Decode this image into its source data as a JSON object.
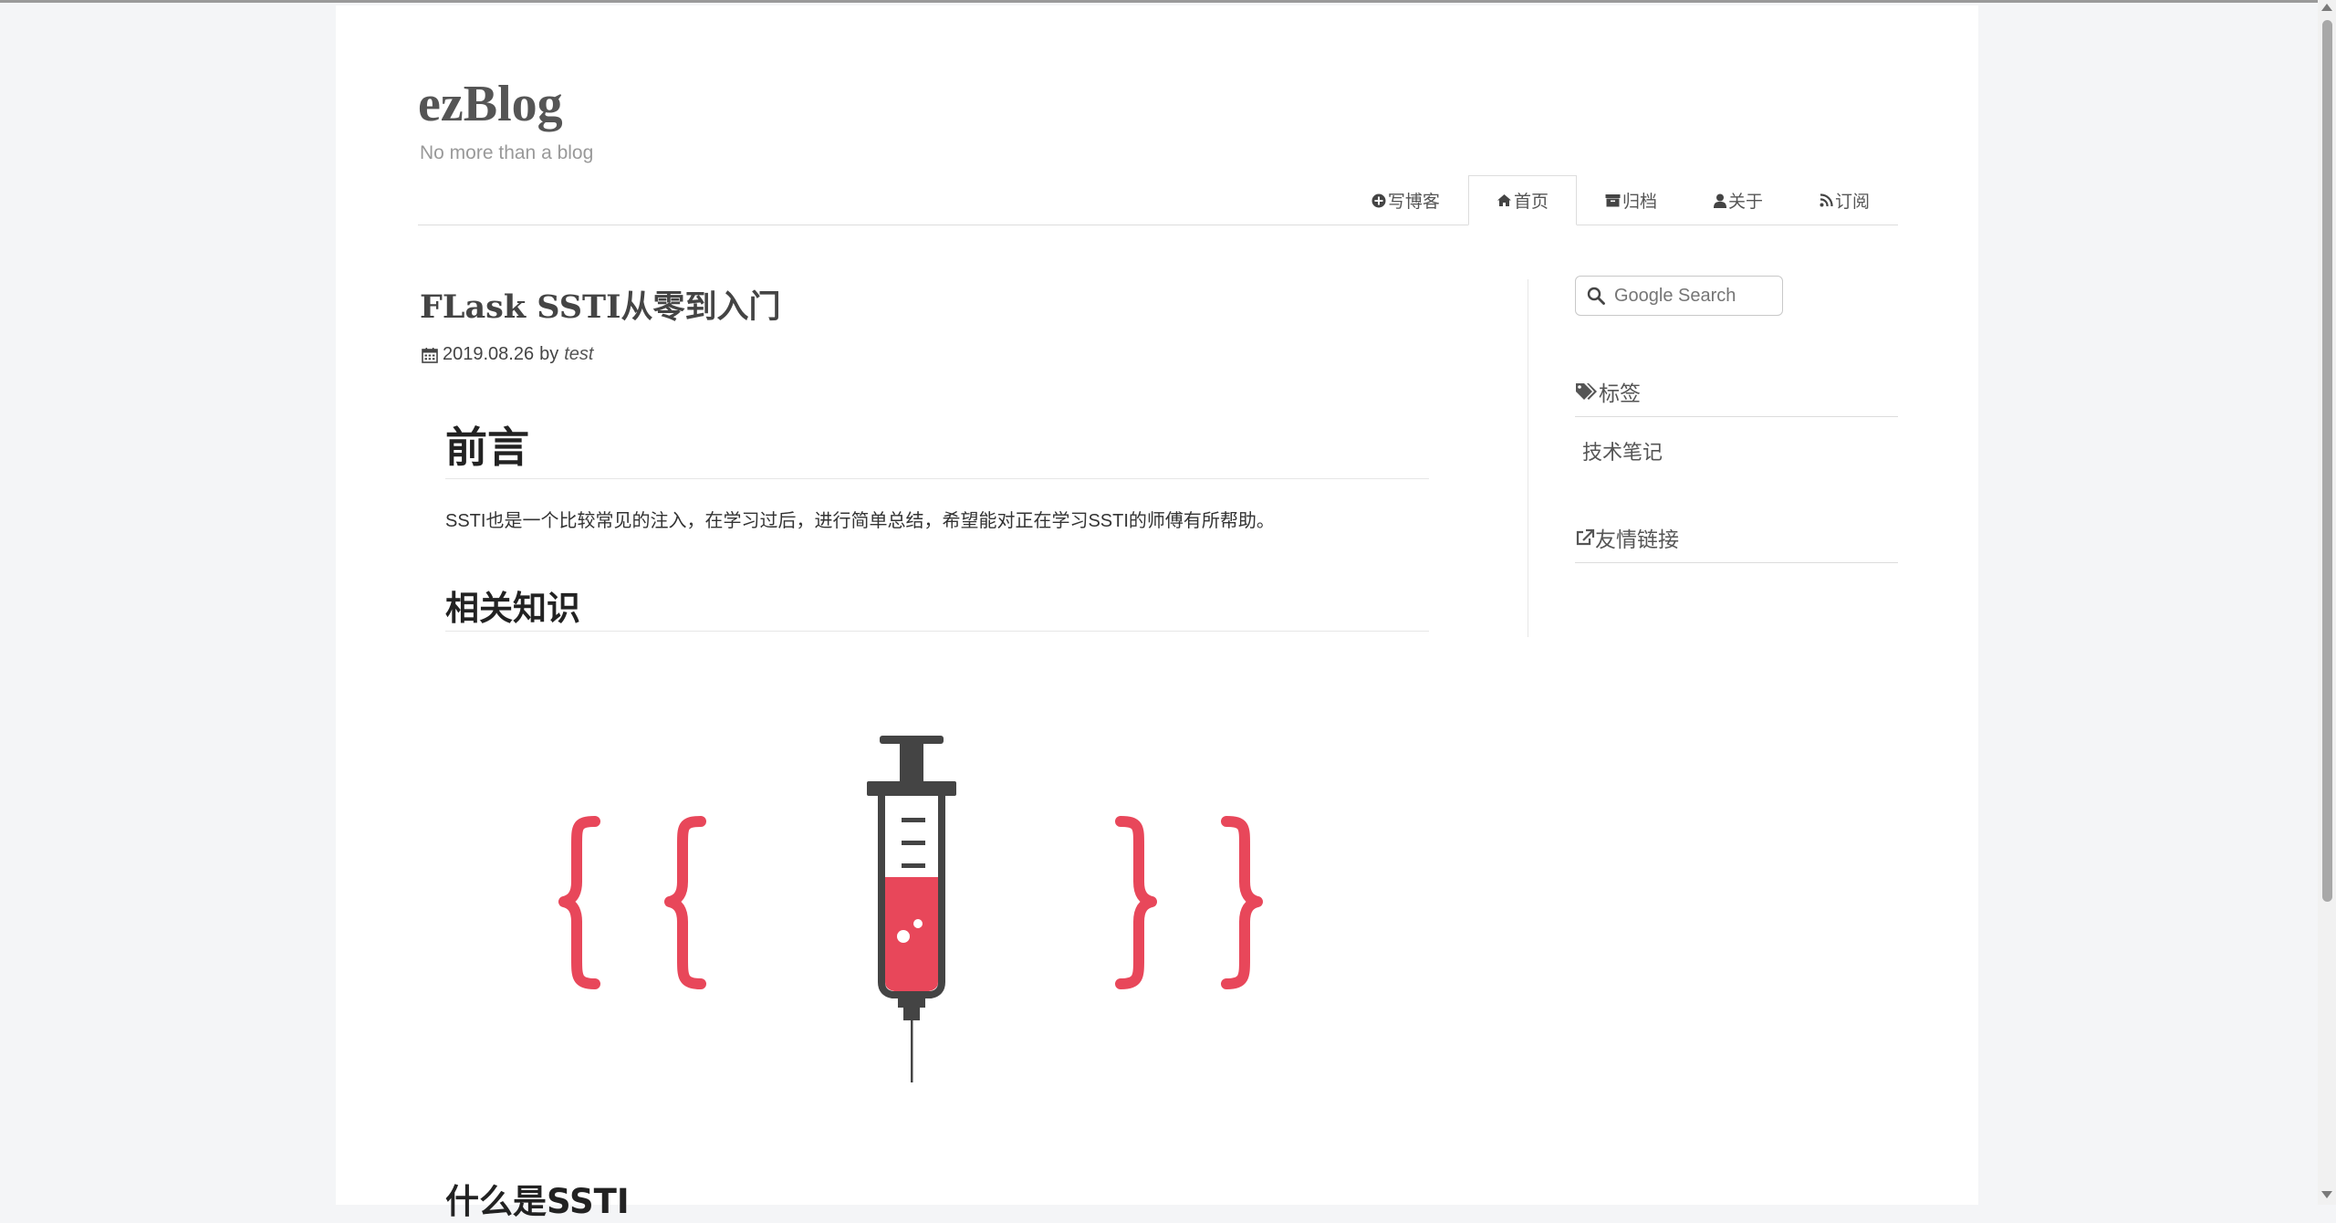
{
  "blog": {
    "title": "ezBlog",
    "subtitle": "No more than a blog"
  },
  "nav": {
    "items": [
      {
        "label": "写博客",
        "icon": "plus-circle-icon"
      },
      {
        "label": "首页",
        "icon": "home-icon",
        "active": true
      },
      {
        "label": "归档",
        "icon": "archive-icon"
      },
      {
        "label": "关于",
        "icon": "user-icon"
      },
      {
        "label": "订阅",
        "icon": "rss-icon"
      }
    ]
  },
  "post": {
    "title": "FLask SSTI从零到入门",
    "date": "2019.08.26",
    "by": "by",
    "author": "test",
    "heading1": "前言",
    "intro": "SSTI也是一个比较常见的注入，在学习过后，进行简单总结，希望能对正在学习SSTI的师傅有所帮助。",
    "heading2": "相关知识",
    "heading3": "什么是SSTI"
  },
  "sidebar": {
    "search_placeholder": "Google Search",
    "tags_title": "标签",
    "tags": [
      "技术笔记"
    ],
    "links_title": "友情链接"
  },
  "colors": {
    "accent_red": "#e8475a",
    "syringe_dark": "#444444"
  }
}
